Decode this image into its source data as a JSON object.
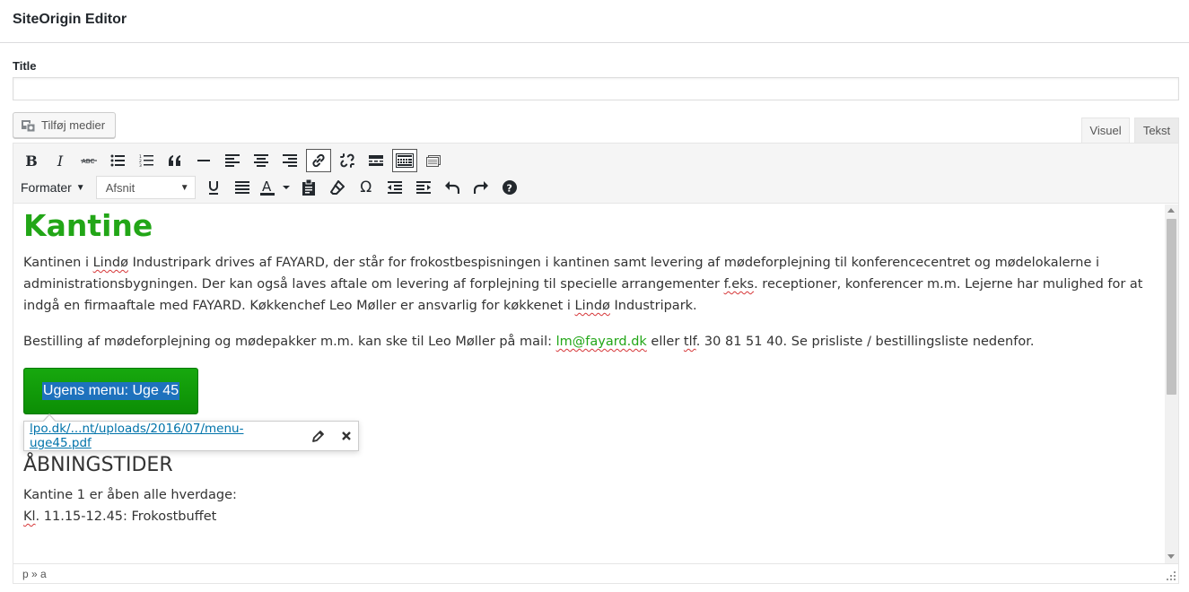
{
  "panel": {
    "title": "SiteOrigin Editor"
  },
  "form": {
    "title_label": "Title",
    "title_value": "",
    "title_placeholder": ""
  },
  "media_button": {
    "label": "Tilføj medier",
    "icon": "add-media-icon"
  },
  "tabs": [
    {
      "label": "Visuel",
      "active": true
    },
    {
      "label": "Tekst",
      "active": false
    }
  ],
  "toolbar": {
    "row1": [
      "bold",
      "italic",
      "strikethrough",
      "bullet-list",
      "numbered-list",
      "blockquote",
      "horizontal-line",
      "align-left",
      "align-center",
      "align-right",
      "insert-link",
      "remove-link",
      "read-more",
      "toolbar-toggle",
      "panels-builder"
    ],
    "row2": [
      "formats",
      "paragraph-select",
      "underline",
      "justify",
      "text-color",
      "paste-as-text",
      "clear-formatting",
      "special-character",
      "outdent",
      "indent",
      "undo",
      "redo",
      "help"
    ],
    "formats_label": "Formater",
    "paragraph_select": "Afsnit"
  },
  "content": {
    "heading": "Kantine",
    "p1_parts": [
      "Kantinen i ",
      "Lindø",
      " Industripark drives af FAYARD, der står for frokostbespisningen i kantinen samt levering af mødeforplejning til konferencecentret og mødelokalerne i administrationsbygningen. Der kan også laves aftale om levering af forplejning til specielle arrangementer ",
      "f.eks",
      ". receptioner, konferencer m.m. Lejerne har mulighed for at indgå en firmaaftale med FAYARD. Køkkenchef Leo Møller er ansvarlig for køkkenet i ",
      "Lindø",
      " Industripark."
    ],
    "p2_parts": [
      "Bestilling af mødeforplejning og mødepakker m.m. kan ske til Leo Møller på mail: ",
      "lm@fayard.dk",
      " eller ",
      "tlf",
      ". 30 81 51 40. Se prisliste / bestillingsliste nedenfor."
    ],
    "button_label": "Ugens menu: Uge 45",
    "link_url": "lpo.dk/...nt/uploads/2016/07/menu-uge45.pdf",
    "sub_heading": "ÅBNINGSTIDER",
    "p3_line1": "Kantine 1 er åben alle hverdage:",
    "p3_parts": [
      "Kl",
      ". 11.15-12.45: Frokostbuffet"
    ]
  },
  "statusbar": {
    "path": "p » a"
  },
  "colors": {
    "heading_green": "#22a617",
    "button_green": "#0c8e05",
    "link_blue": "#0073aa",
    "selection_blue": "#1e72bd"
  }
}
